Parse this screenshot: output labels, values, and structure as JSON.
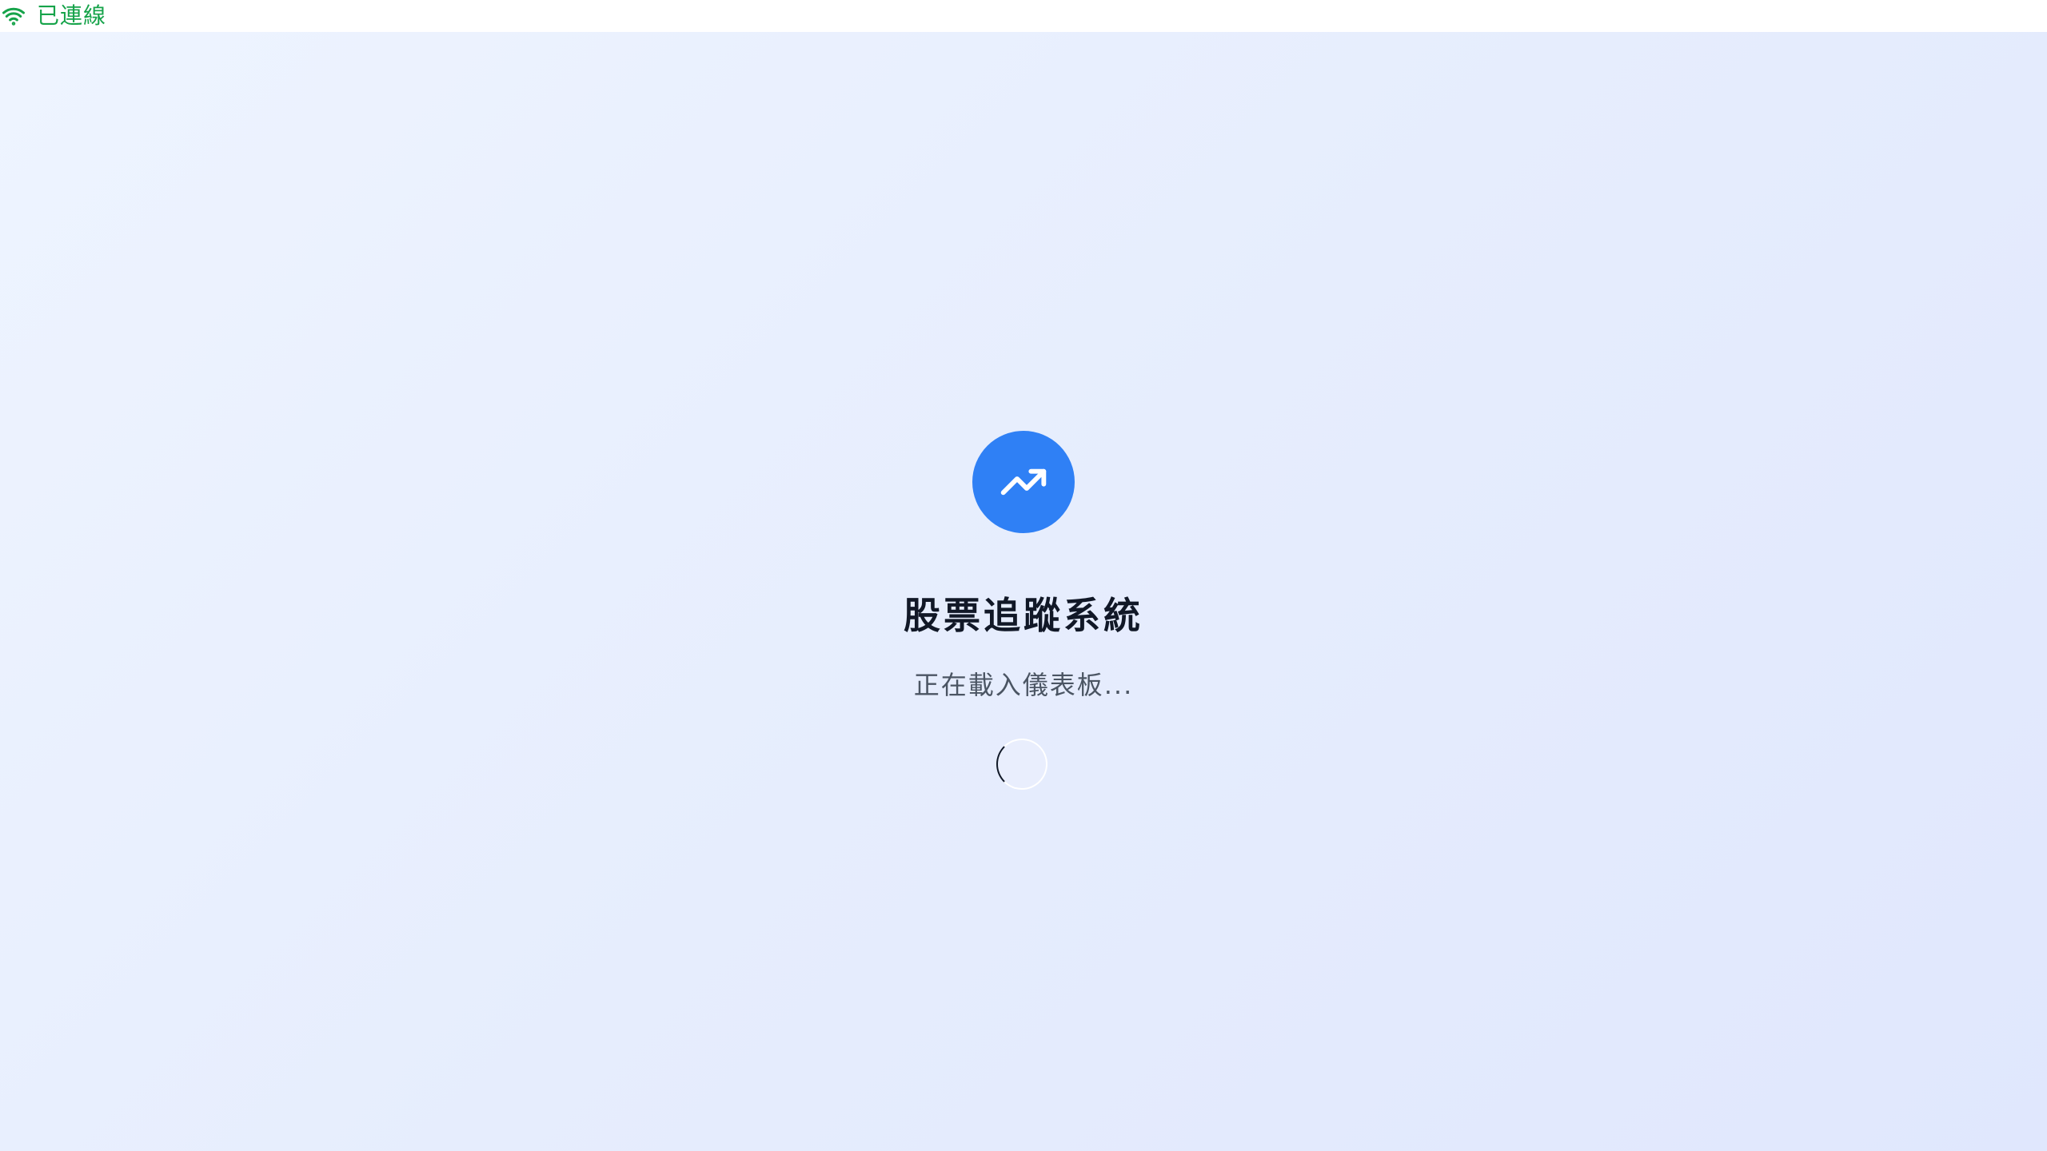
{
  "status": {
    "icon": "wifi-icon",
    "text": "已連線",
    "color": "#16a34a"
  },
  "loader": {
    "logo_icon": "trending-up-icon",
    "logo_color": "#2f80f5",
    "title": "股票追蹤系統",
    "message": "正在載入儀表板...",
    "spinner_icon": "loading-spinner"
  }
}
